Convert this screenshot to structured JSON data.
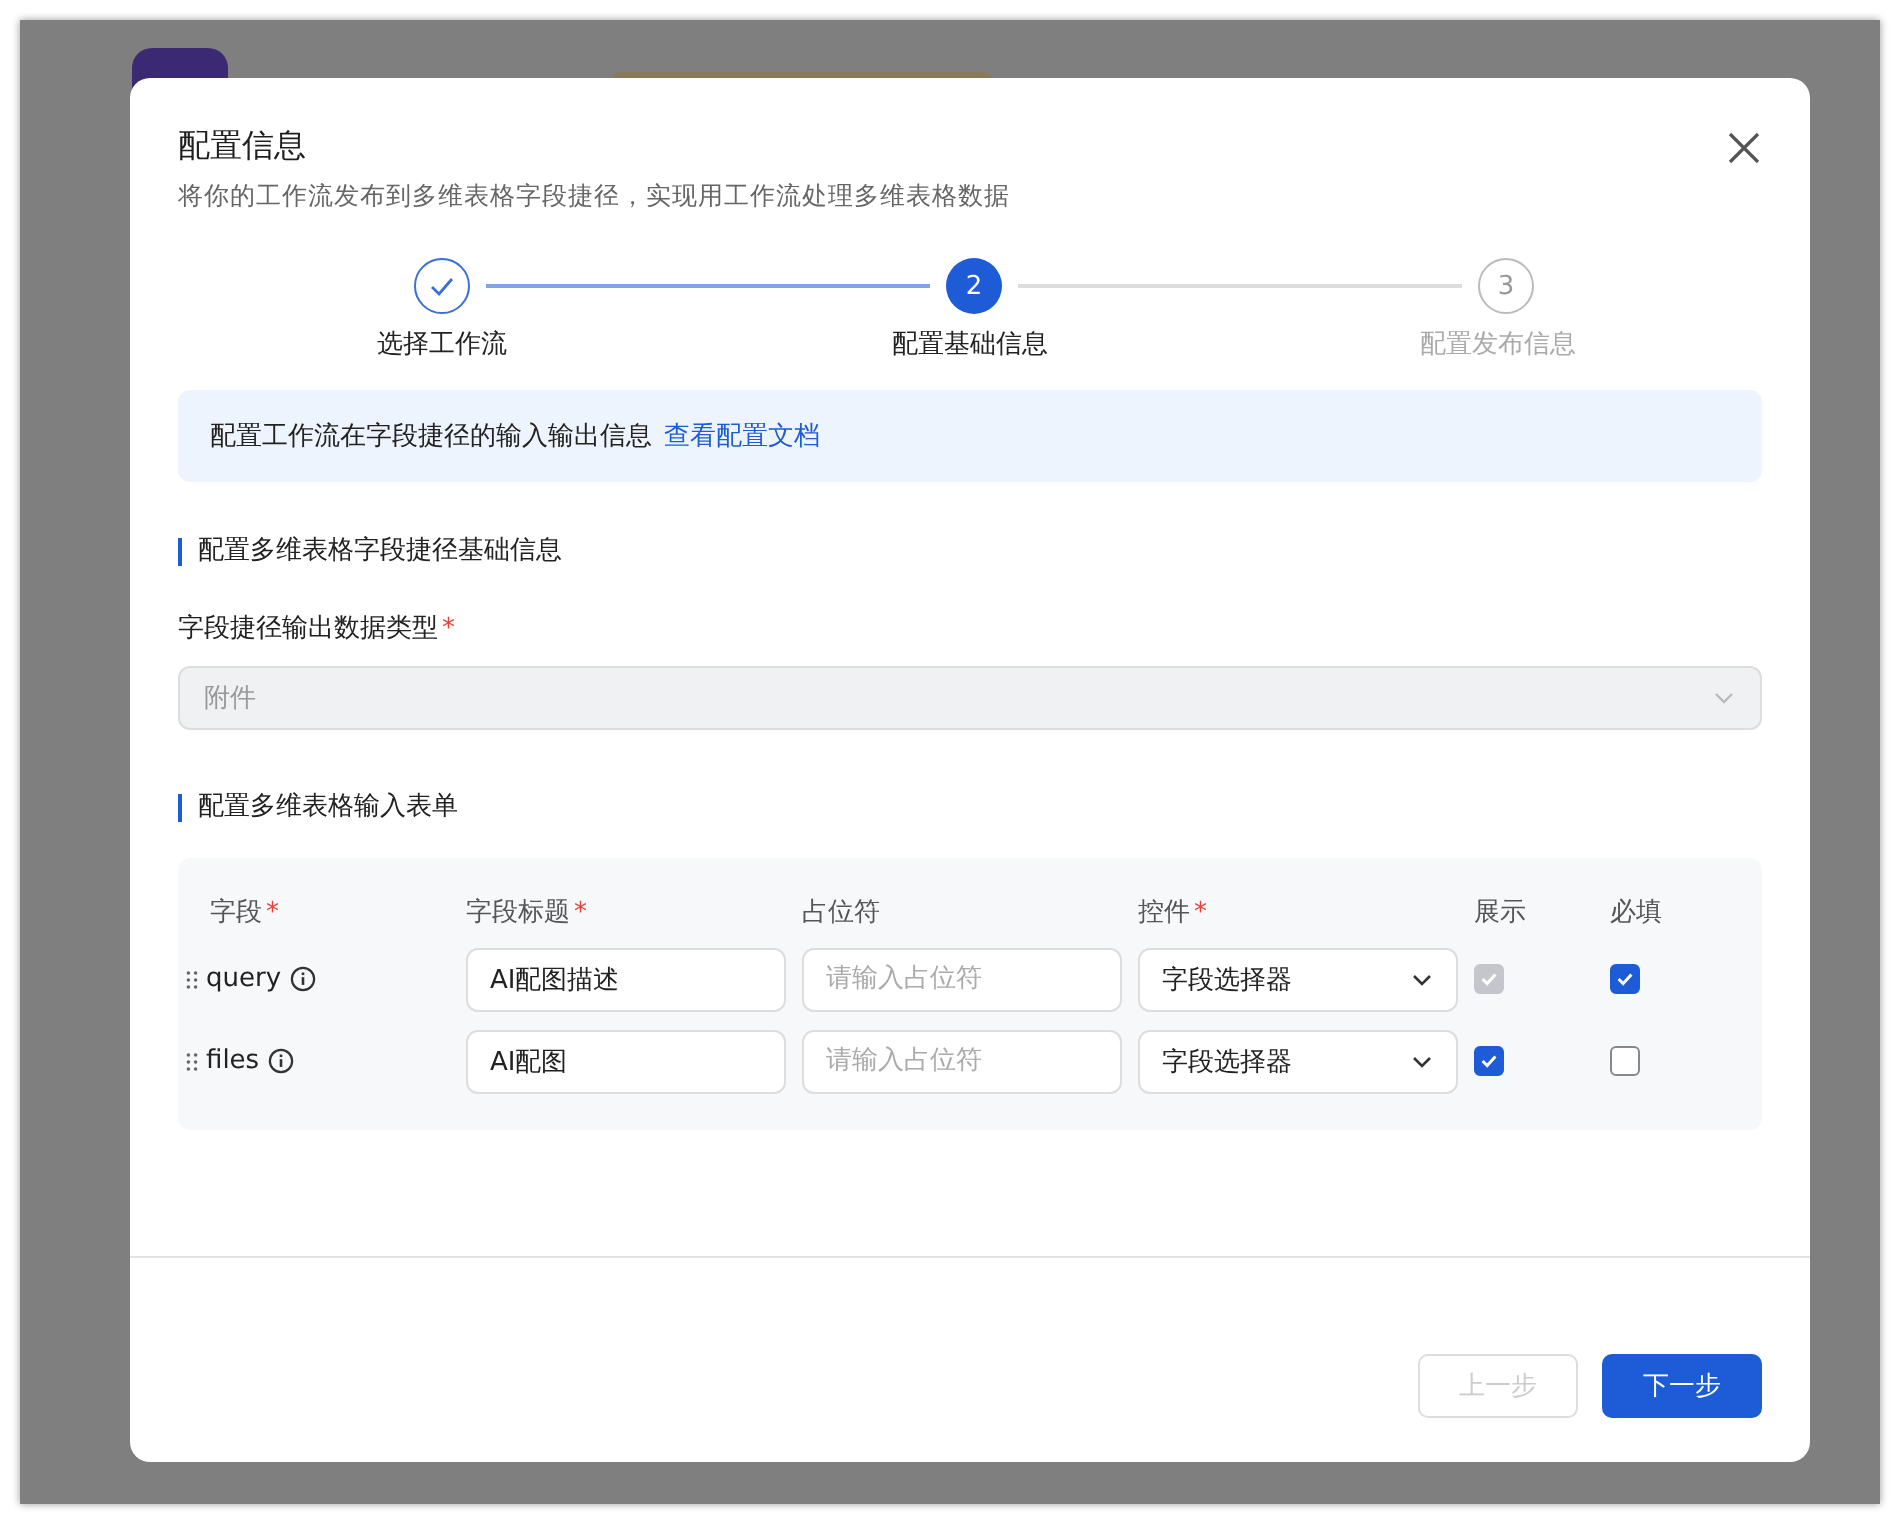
{
  "dialog": {
    "title": "配置信息",
    "subtitle": "将你的工作流发布到多维表格字段捷径，实现用工作流处理多维表格数据"
  },
  "steps": [
    {
      "label": "选择工作流",
      "completed": true,
      "selected": false
    },
    {
      "number": "2",
      "label": "配置基础信息",
      "completed": false,
      "selected": true
    },
    {
      "number": "3",
      "label": "配置发布信息",
      "completed": false,
      "selected": false
    }
  ],
  "info": {
    "text": "配置工作流在字段捷径的输入输出信息",
    "link": "查看配置文档"
  },
  "section_basic": {
    "heading": "配置多维表格字段捷径基础信息",
    "field_label": "字段捷径输出数据类型",
    "required_mark": "*",
    "select_value": "附件",
    "disabled": true
  },
  "section_form": {
    "heading": "配置多维表格输入表单"
  },
  "table": {
    "columns": [
      {
        "label": "字段",
        "required_mark": "*"
      },
      {
        "label": "字段标题",
        "required_mark": "*"
      },
      {
        "label": "占位符"
      },
      {
        "label": "控件",
        "required_mark": "*"
      },
      {
        "label": "展示"
      },
      {
        "label": "必填"
      }
    ],
    "rows": [
      {
        "field": "query",
        "title": "AI配图描述",
        "placeholder": "请输入占位符",
        "control": "字段选择器",
        "show": {
          "checked": true,
          "disabled": true
        },
        "required": {
          "checked": true,
          "disabled": false
        }
      },
      {
        "field": "files",
        "title": "AI配图",
        "placeholder": "请输入占位符",
        "control": "字段选择器",
        "show": {
          "checked": true,
          "disabled": false
        },
        "required": {
          "checked": false,
          "disabled": false
        }
      }
    ]
  },
  "buttons": [
    {
      "label": "上一步",
      "kind": "secondary",
      "disabled": true
    },
    {
      "label": "下一步",
      "kind": "primary",
      "disabled": false
    }
  ]
}
